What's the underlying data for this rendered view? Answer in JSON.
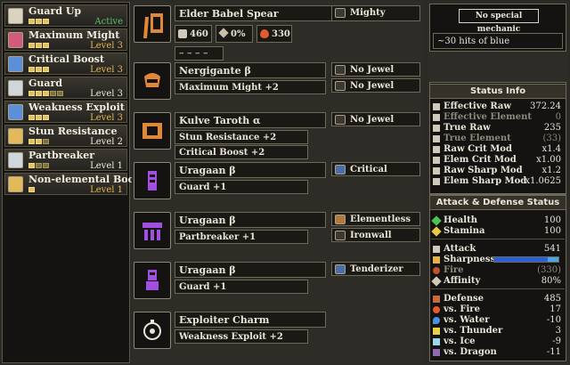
{
  "skills": [
    {
      "name": "Guard Up",
      "level": "Active",
      "pips": 3,
      "filled": 3,
      "style": "green",
      "icon_color": "#d9d3bf"
    },
    {
      "name": "Maximum Might",
      "level": "Level 3",
      "pips": 3,
      "filled": 3,
      "style": "orange",
      "icon_color": "#d25a7a"
    },
    {
      "name": "Critical Boost",
      "level": "Level 3",
      "pips": 3,
      "filled": 3,
      "style": "orange",
      "icon_color": "#5b8fd8"
    },
    {
      "name": "Guard",
      "level": "Level 3",
      "pips": 5,
      "filled": 3,
      "style": "white",
      "icon_color": "#cfd6dc"
    },
    {
      "name": "Weakness Exploit",
      "level": "Level 3",
      "pips": 3,
      "filled": 3,
      "style": "orange",
      "icon_color": "#5b8fd8"
    },
    {
      "name": "Stun Resistance",
      "level": "Level 2",
      "pips": 3,
      "filled": 2,
      "style": "white",
      "icon_color": "#e4b95a"
    },
    {
      "name": "Partbreaker",
      "level": "Level 1",
      "pips": 3,
      "filled": 1,
      "style": "white",
      "icon_color": "#cfd6dc"
    },
    {
      "name": "Non-elemental Boost",
      "level": "Level 1",
      "pips": 1,
      "filled": 1,
      "style": "orange",
      "icon_color": "#e4b95a"
    }
  ],
  "weapon": {
    "name": "Elder Babel Spear",
    "attack": "460",
    "affinity": "0%",
    "element": "330",
    "slots": "– – – –",
    "augment": "Mighty"
  },
  "armor": [
    {
      "name": "Nergigante β",
      "skill": "Maximum Might +2",
      "jewels": [
        "No Jewel",
        "No Jewel"
      ]
    },
    {
      "name": "Kulve Taroth α",
      "skill": "Stun Resistance +2",
      "skill2": "Critical Boost +2",
      "jewels": [
        "No Jewel"
      ]
    },
    {
      "name": "Uragaan β",
      "skill": "Guard +1",
      "jewels": [
        "Critical"
      ]
    },
    {
      "name": "Uragaan β",
      "skill": "Partbreaker +1",
      "jewels": [
        "Elementless",
        "Ironwall"
      ]
    },
    {
      "name": "Uragaan β",
      "skill": "Guard +1",
      "jewels": [
        "Tenderizer"
      ]
    },
    {
      "name": "Exploiter Charm",
      "skill": "Weakness Exploit +2",
      "jewels": []
    }
  ],
  "mechanic": {
    "title": "No special mechanic",
    "desc": "~30 hits of blue"
  },
  "status": {
    "header": "Status Info",
    "rows": [
      {
        "k": "Effective Raw",
        "v": "372.24",
        "dim": false
      },
      {
        "k": "Effective Element",
        "v": "0",
        "dim": true
      },
      {
        "k": "True Raw",
        "v": "235",
        "dim": false
      },
      {
        "k": "True Element",
        "v": "(33)",
        "dim": true
      },
      {
        "k": "Raw Crit Mod",
        "v": "x1.4",
        "dim": false
      },
      {
        "k": "Elem Crit Mod",
        "v": "x1.00",
        "dim": false
      },
      {
        "k": "Raw Sharp Mod",
        "v": "x1.2",
        "dim": false
      },
      {
        "k": "Elem Sharp Mod",
        "v": "x1.0625",
        "dim": false
      }
    ]
  },
  "ad": {
    "header": "Attack & Defense Status",
    "health": {
      "k": "Health",
      "v": "100"
    },
    "stamina": {
      "k": "Stamina",
      "v": "100"
    },
    "attack": {
      "k": "Attack",
      "v": "541"
    },
    "sharpness": {
      "k": "Sharpness",
      "v": ""
    },
    "fire": {
      "k": "Fire",
      "v": "(330)"
    },
    "affinity": {
      "k": "Affinity",
      "v": "80%"
    },
    "defense": {
      "k": "Defense",
      "v": "485"
    },
    "vs_fire": {
      "k": "vs. Fire",
      "v": "17"
    },
    "vs_water": {
      "k": "vs. Water",
      "v": "-10"
    },
    "vs_thunder": {
      "k": "vs. Thunder",
      "v": "3"
    },
    "vs_ice": {
      "k": "vs. Ice",
      "v": "-9"
    },
    "vs_dragon": {
      "k": "vs. Dragon",
      "v": "-11"
    }
  },
  "colors": {
    "accent": "#e7b94d",
    "active": "#57c46a",
    "armor_icon": "#e0883a",
    "uragaan_icon": "#a04fe0"
  }
}
